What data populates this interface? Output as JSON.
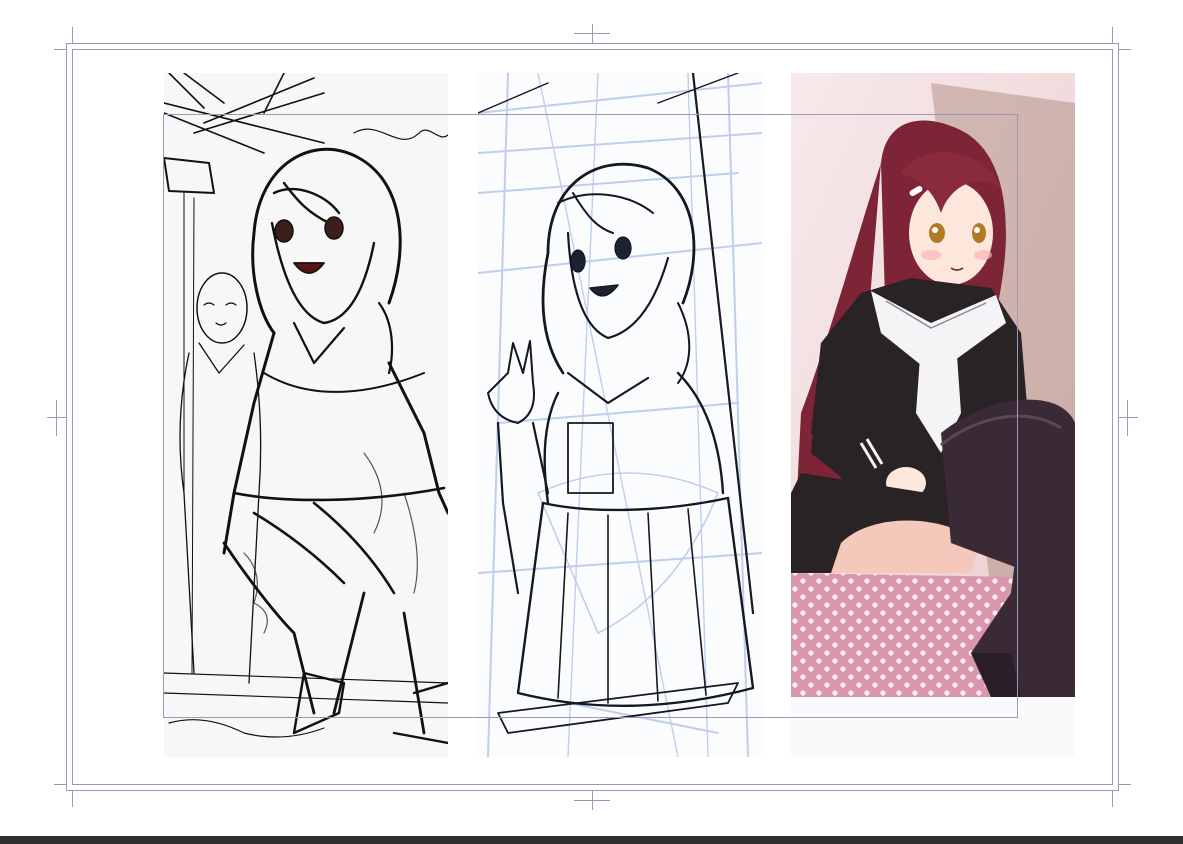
{
  "document": {
    "panels": [
      {
        "id": "rough-sketch",
        "stage": "sketch"
      },
      {
        "id": "line-art",
        "stage": "lineart"
      },
      {
        "id": "final-illustration",
        "stage": "color"
      }
    ]
  },
  "colors": {
    "background": "#ffffff",
    "guide_lines": "#9a9ab8",
    "sketch_paper": "#f7f7f7",
    "lineart_blue": "#bcd0ee",
    "hair": "#7e2437",
    "uniform": "#2a2326",
    "collar": "#f4f4f6",
    "stocking": "#3a2a36",
    "polka_cloth": "#d996ad",
    "backdrop": "#f1d5d6",
    "status_bar": "#2f2f31"
  },
  "icons": [
    "crop-mark-top-icon",
    "crop-mark-bottom-icon",
    "crop-mark-left-icon",
    "crop-mark-right-icon"
  ]
}
